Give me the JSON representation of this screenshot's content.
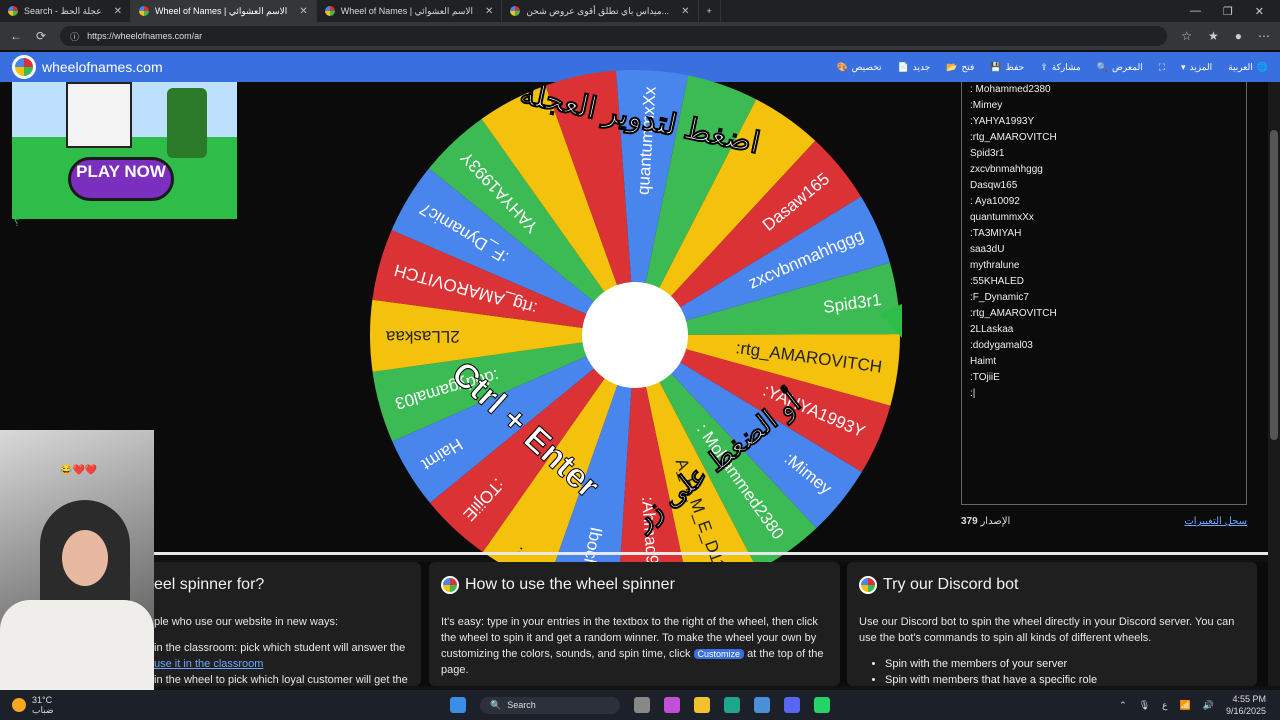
{
  "browser": {
    "tabs": [
      {
        "label": "Search - عجلة الحظ",
        "active": false
      },
      {
        "label": "Wheel of Names | الاسم العشوائي",
        "active": true
      },
      {
        "label": "Wheel of Names | الاسم العشوائي",
        "active": false
      },
      {
        "label": "ميداس باي تطلق أقوى عروض شحن...",
        "active": false
      }
    ],
    "new_tab": "+",
    "url": "https://wheelofnames.com/ar"
  },
  "app": {
    "logo_text": "wheelofnames.com",
    "nav": [
      "تخصيص",
      "جديد",
      "فتح",
      "حفظ",
      "مشاركة",
      "المعرض",
      "المزيد",
      "العربية"
    ]
  },
  "ad": {
    "play_label": "PLAY NOW",
    "caption": "؟"
  },
  "wheel": {
    "segments": [
      {
        "label": "Spid3r1",
        "color": "#3cba54"
      },
      {
        "label": ":rtg_AMAROVITCH",
        "color": "#f4c20d"
      },
      {
        "label": ":YAHYA1993Y",
        "color": "#db3236"
      },
      {
        "label": ":Mimey",
        "color": "#4885ed"
      },
      {
        "label": ": Mohammed2380",
        "color": "#3cba54"
      },
      {
        "label": "A_H_M_E_D11",
        "color": "#f4c20d"
      },
      {
        "label": ":Ahmad90q",
        "color": "#db3236"
      },
      {
        "label": "Ibochiji",
        "color": "#4885ed"
      },
      {
        "label": "..",
        "color": "#f4c20d"
      },
      {
        "label": ":TOjiiE",
        "color": "#db3236"
      },
      {
        "label": "Haimt",
        "color": "#4885ed"
      },
      {
        "label": ":dodygamal03",
        "color": "#3cba54"
      },
      {
        "label": "2LLaskaa",
        "color": "#f4c20d"
      },
      {
        "label": ":rtg_AMAROVITCH",
        "color": "#db3236"
      },
      {
        "label": ":F_Dynamic7",
        "color": "#4885ed"
      },
      {
        "label": "YAHYA1993Y",
        "color": "#3cba54"
      },
      {
        "label": "",
        "color": "#f4c20d"
      },
      {
        "label": "",
        "color": "#db3236"
      },
      {
        "label": "quantummxXx",
        "color": "#4885ed"
      },
      {
        "label": "",
        "color": "#3cba54"
      },
      {
        "label": "",
        "color": "#f4c20d"
      },
      {
        "label": "Dasaw165",
        "color": "#db3236"
      },
      {
        "label": "zxcvbnmahhggg",
        "color": "#4885ed"
      }
    ],
    "overlay_top": "اضغط لتدوير العجلة",
    "overlay_bottom_en": "Ctrl + Enter",
    "overlay_bottom_ar": "أو الضغط على زر"
  },
  "entries": [
    ": Mohammed2380",
    ":Mimey",
    ":YAHYA1993Y",
    ":rtg_AMAROVITCH",
    "Spid3r1",
    "zxcvbnmahhggg",
    "Dasqw165",
    ": Aya10092",
    "quantummxXx",
    ":TA3MIYAH",
    "saa3dU",
    "mythralune",
    ":55KHALED",
    ":F_Dynamic7",
    ":rtg_AMAROVITCH",
    "2LLaskaa",
    ":dodygamal03",
    "Haimt",
    ":TOjiiE",
    ":|"
  ],
  "version": {
    "label": "الإصدار",
    "number": "379",
    "changelog": "سجل التغييرات"
  },
  "cards": [
    {
      "title": "eel spinner for?",
      "intro": "ple who use our website in new ways:",
      "line1": "in the classroom: pick which student will answer the",
      "link": "use it in the classroom",
      "line2": "in the wheel to pick which loyal customer will get the"
    },
    {
      "title": "How to use the wheel spinner",
      "body_before": "It's easy: type in your entries in the textbox to the right of the wheel, then click the wheel to spin it and get a random winner. To make the wheel your own by customizing the colors, sounds, and spin time, click",
      "pill": "Customize",
      "body_after": "at the top of the page."
    },
    {
      "title": "Try our Discord bot",
      "body": "Use our Discord bot to spin the wheel directly in your Discord server. You can use the bot's commands to spin all kinds of different wheels.",
      "bullets": [
        "Spin with the members of your server",
        "Spin with members that have a specific role"
      ]
    }
  ],
  "webcam": {
    "hearts": "😂❤️❤️"
  },
  "taskbar": {
    "temp": "31°C",
    "weather_text": "ضباب",
    "search": "Search",
    "time": "4:55 PM",
    "date": "9/16/2025",
    "lang": "ع"
  }
}
